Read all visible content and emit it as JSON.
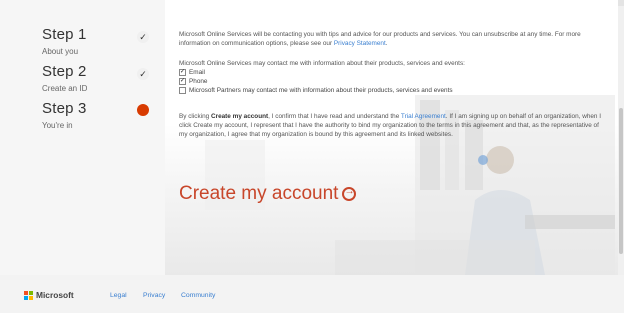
{
  "steps": [
    {
      "title": "Step 1",
      "subtitle": "About you",
      "status": "complete",
      "status_icon": "check-icon",
      "status_glyph": "✓"
    },
    {
      "title": "Step 2",
      "subtitle": "Create an ID",
      "status": "complete",
      "status_icon": "check-icon",
      "status_glyph": "✓"
    },
    {
      "title": "Step 3",
      "subtitle": "You're in",
      "status": "current",
      "status_icon": "current-dot-icon",
      "status_glyph": ""
    }
  ],
  "contact_notice": {
    "text": "Microsoft Online Services will be contacting you with tips and advice for our products and services. You can unsubscribe at any time. For more information on communication options, please see our ",
    "link": "Privacy Statement",
    "end": "."
  },
  "consent": {
    "intro": "Microsoft Online Services may contact me with information about their products, services and events:",
    "options": [
      {
        "label": "Email",
        "checked": true
      },
      {
        "label": "Phone",
        "checked": true
      },
      {
        "label": "Microsoft Partners may contact me with information about their products, services and events",
        "checked": false
      }
    ]
  },
  "agreement": {
    "part1": "By clicking ",
    "bold": "Create my account",
    "part2": ", I confirm that I have read and understand the ",
    "link": "Trial Agreement",
    "part3": ". If I am signing up on behalf of an organization, when I click Create my account, I represent that I have the authority to bind my organization to the terms in this agreement and that, as the representative of my organization, I agree that my organization is bound by this agreement and its linked websites."
  },
  "create_button": {
    "label": "Create my account",
    "icon": "arrow-right-circle-icon"
  },
  "footer": {
    "brand": "Microsoft",
    "links": [
      "Legal",
      "Privacy",
      "Community"
    ]
  },
  "colors": {
    "accent": "#d83b01",
    "link": "#3a7fd0",
    "ms_red": "#f25022",
    "ms_green": "#7fba00",
    "ms_blue": "#00a4ef",
    "ms_yellow": "#ffb900"
  }
}
